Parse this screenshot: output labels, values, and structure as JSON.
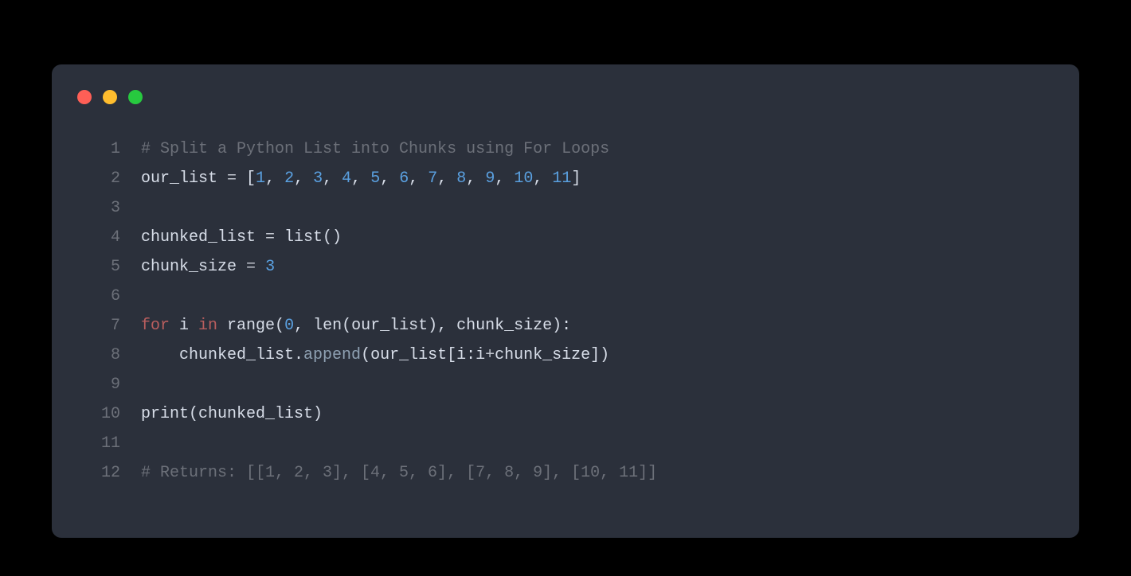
{
  "colors": {
    "background": "#000000",
    "panel": "#2b303b",
    "traffic": {
      "red": "#ff5f56",
      "yellow": "#ffbd2e",
      "green": "#27c93f"
    },
    "lineNumber": "#6c7079",
    "comment": "#6c7079",
    "default": "#d8dee9",
    "operator": "#c0c5ce",
    "number": "#5aa0e0",
    "keyword": "#b95e5e",
    "method": "#8fa1b3"
  },
  "code": {
    "language": "python",
    "lines": [
      {
        "num": "1",
        "tokens": [
          {
            "t": "# Split a Python List into Chunks using For Loops",
            "c": "comment"
          }
        ]
      },
      {
        "num": "2",
        "tokens": [
          {
            "t": "our_list ",
            "c": "default"
          },
          {
            "t": "=",
            "c": "op"
          },
          {
            "t": " [",
            "c": "default"
          },
          {
            "t": "1",
            "c": "num"
          },
          {
            "t": ", ",
            "c": "default"
          },
          {
            "t": "2",
            "c": "num"
          },
          {
            "t": ", ",
            "c": "default"
          },
          {
            "t": "3",
            "c": "num"
          },
          {
            "t": ", ",
            "c": "default"
          },
          {
            "t": "4",
            "c": "num"
          },
          {
            "t": ", ",
            "c": "default"
          },
          {
            "t": "5",
            "c": "num"
          },
          {
            "t": ", ",
            "c": "default"
          },
          {
            "t": "6",
            "c": "num"
          },
          {
            "t": ", ",
            "c": "default"
          },
          {
            "t": "7",
            "c": "num"
          },
          {
            "t": ", ",
            "c": "default"
          },
          {
            "t": "8",
            "c": "num"
          },
          {
            "t": ", ",
            "c": "default"
          },
          {
            "t": "9",
            "c": "num"
          },
          {
            "t": ", ",
            "c": "default"
          },
          {
            "t": "10",
            "c": "num"
          },
          {
            "t": ", ",
            "c": "default"
          },
          {
            "t": "11",
            "c": "num"
          },
          {
            "t": "]",
            "c": "default"
          }
        ]
      },
      {
        "num": "3",
        "tokens": []
      },
      {
        "num": "4",
        "tokens": [
          {
            "t": "chunked_list ",
            "c": "default"
          },
          {
            "t": "=",
            "c": "op"
          },
          {
            "t": " list()",
            "c": "default"
          }
        ]
      },
      {
        "num": "5",
        "tokens": [
          {
            "t": "chunk_size ",
            "c": "default"
          },
          {
            "t": "=",
            "c": "op"
          },
          {
            "t": " ",
            "c": "default"
          },
          {
            "t": "3",
            "c": "num"
          }
        ]
      },
      {
        "num": "6",
        "tokens": []
      },
      {
        "num": "7",
        "tokens": [
          {
            "t": "for",
            "c": "keyword"
          },
          {
            "t": " i ",
            "c": "default"
          },
          {
            "t": "in",
            "c": "keyword"
          },
          {
            "t": " range(",
            "c": "default"
          },
          {
            "t": "0",
            "c": "num"
          },
          {
            "t": ", len(our_list), chunk_size):",
            "c": "default"
          }
        ]
      },
      {
        "num": "8",
        "tokens": [
          {
            "t": "    chunked_list.",
            "c": "default"
          },
          {
            "t": "append",
            "c": "method"
          },
          {
            "t": "(our_list[i:i",
            "c": "default"
          },
          {
            "t": "+",
            "c": "op"
          },
          {
            "t": "chunk_size])",
            "c": "default"
          }
        ]
      },
      {
        "num": "9",
        "tokens": []
      },
      {
        "num": "10",
        "tokens": [
          {
            "t": "print",
            "c": "default"
          },
          {
            "t": "(chunked_list)",
            "c": "default"
          }
        ]
      },
      {
        "num": "11",
        "tokens": []
      },
      {
        "num": "12",
        "tokens": [
          {
            "t": "# Returns: [[1, 2, 3], [4, 5, 6], [7, 8, 9], [10, 11]]",
            "c": "comment"
          }
        ]
      }
    ]
  }
}
